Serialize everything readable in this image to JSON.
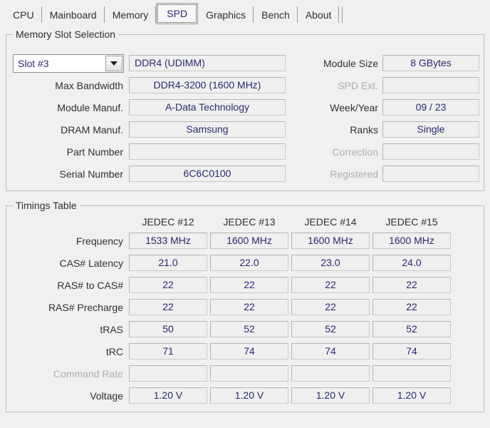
{
  "tabs": [
    {
      "label": "CPU",
      "active": false
    },
    {
      "label": "Mainboard",
      "active": false
    },
    {
      "label": "Memory",
      "active": false
    },
    {
      "label": "SPD",
      "active": true
    },
    {
      "label": "Graphics",
      "active": false
    },
    {
      "label": "Bench",
      "active": false
    },
    {
      "label": "About",
      "active": false
    }
  ],
  "slot_section": {
    "title": "Memory Slot Selection",
    "slot_selector": {
      "value": "Slot #3",
      "arrow_icon": "chevron-down-icon"
    },
    "module_type": "DDR4 (UDIMM)",
    "left_rows": [
      {
        "label": "Max Bandwidth",
        "value": "DDR4-3200 (1600 MHz)",
        "disabled": false
      },
      {
        "label": "Module Manuf.",
        "value": "A-Data Technology",
        "disabled": false
      },
      {
        "label": "DRAM Manuf.",
        "value": "Samsung",
        "disabled": false
      },
      {
        "label": "Part Number",
        "value": "",
        "disabled": false
      },
      {
        "label": "Serial Number",
        "value": "6C6C0100",
        "disabled": false
      }
    ],
    "right_rows": [
      {
        "label": "Module Size",
        "value": "8 GBytes",
        "disabled": false
      },
      {
        "label": "SPD Ext.",
        "value": "",
        "disabled": true
      },
      {
        "label": "Week/Year",
        "value": "09 / 23",
        "disabled": false
      },
      {
        "label": "Ranks",
        "value": "Single",
        "disabled": false
      },
      {
        "label": "Correction",
        "value": "",
        "disabled": true
      },
      {
        "label": "Registered",
        "value": "",
        "disabled": true
      }
    ]
  },
  "timings_section": {
    "title": "Timings Table",
    "columns": [
      "JEDEC #12",
      "JEDEC #13",
      "JEDEC #14",
      "JEDEC #15"
    ],
    "rows": [
      {
        "label": "Frequency",
        "disabled": false,
        "values": [
          "1533 MHz",
          "1600 MHz",
          "1600 MHz",
          "1600 MHz"
        ]
      },
      {
        "label": "CAS# Latency",
        "disabled": false,
        "values": [
          "21.0",
          "22.0",
          "23.0",
          "24.0"
        ]
      },
      {
        "label": "RAS# to CAS#",
        "disabled": false,
        "values": [
          "22",
          "22",
          "22",
          "22"
        ]
      },
      {
        "label": "RAS# Precharge",
        "disabled": false,
        "values": [
          "22",
          "22",
          "22",
          "22"
        ]
      },
      {
        "label": "tRAS",
        "disabled": false,
        "values": [
          "50",
          "52",
          "52",
          "52"
        ]
      },
      {
        "label": "tRC",
        "disabled": false,
        "values": [
          "71",
          "74",
          "74",
          "74"
        ]
      },
      {
        "label": "Command Rate",
        "disabled": true,
        "values": [
          "",
          "",
          "",
          ""
        ]
      },
      {
        "label": "Voltage",
        "disabled": false,
        "values": [
          "1.20 V",
          "1.20 V",
          "1.20 V",
          "1.20 V"
        ]
      }
    ]
  },
  "colors": {
    "value_text": "#2a2a72",
    "label_text": "#303030",
    "disabled_text": "#aeaeae",
    "field_bg": "#efefef",
    "window_bg": "#f0f0f0",
    "border": "#bdbdbd"
  }
}
